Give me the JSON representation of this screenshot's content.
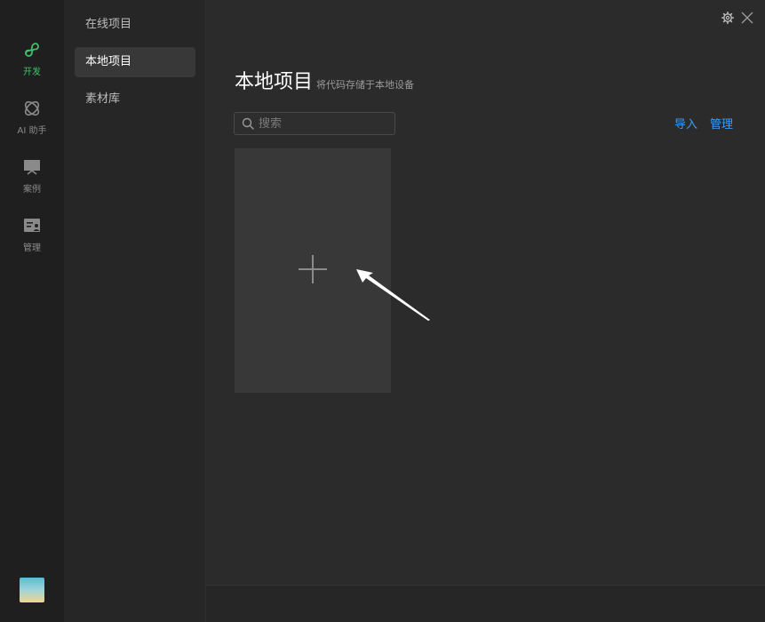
{
  "rail": {
    "items": [
      {
        "label": "开发",
        "icon": "miniprogram-icon",
        "active": true
      },
      {
        "label": "AI 助手",
        "icon": "ai-assistant-icon",
        "active": false
      },
      {
        "label": "案例",
        "icon": "showcase-icon",
        "active": false
      },
      {
        "label": "管理",
        "icon": "manage-icon",
        "active": false
      }
    ],
    "active_color": "#3fc06b"
  },
  "subnav": {
    "items": [
      {
        "label": "在线项目",
        "active": false
      },
      {
        "label": "本地项目",
        "active": true
      },
      {
        "label": "素材库",
        "active": false
      }
    ]
  },
  "main": {
    "title": "本地项目",
    "subtitle": "将代码存储于本地设备",
    "search": {
      "placeholder": "搜索",
      "value": ""
    },
    "actions": {
      "import_label": "导入",
      "manage_label": "管理"
    },
    "link_color": "#3d9cf5",
    "new_project_icon": "plus-icon"
  },
  "window": {
    "settings_icon": "gear-icon",
    "close_icon": "close-icon"
  }
}
